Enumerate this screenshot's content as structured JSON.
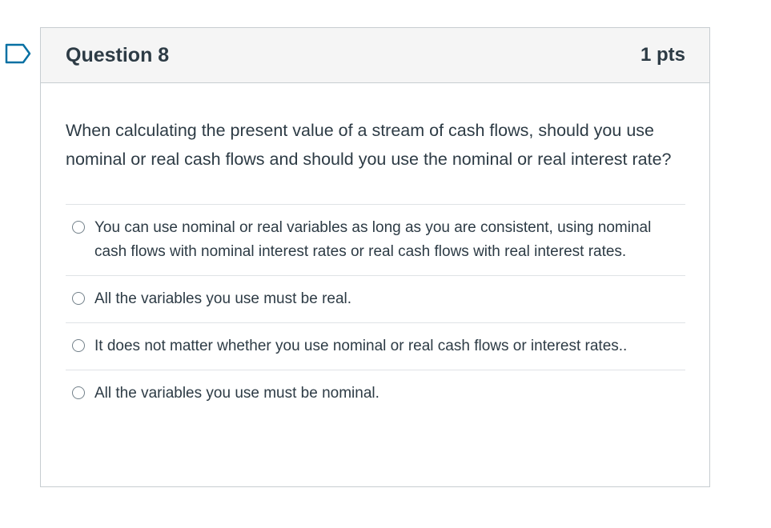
{
  "question": {
    "title": "Question 8",
    "points": "1 pts",
    "text": "When calculating the present value of a stream of cash flows, should you use nominal or real cash flows and should you use the nominal or real interest rate?",
    "answers": [
      {
        "label": "You can use nominal or real variables as long as you are consistent, using nominal cash flows with nominal interest rates or real cash flows with real interest rates.",
        "selected": false
      },
      {
        "label": "All the variables you use must be real.",
        "selected": false
      },
      {
        "label": "It does not matter whether you use nominal or real cash flows or interest rates..",
        "selected": false
      },
      {
        "label": "All the variables you use must be nominal.",
        "selected": false
      }
    ]
  },
  "icons": {
    "flag": "bookmark-flag-icon"
  },
  "colors": {
    "accent": "#0770a3",
    "header_bg": "#f5f5f5",
    "border": "#c7cdd1",
    "text": "#2d3b45"
  }
}
